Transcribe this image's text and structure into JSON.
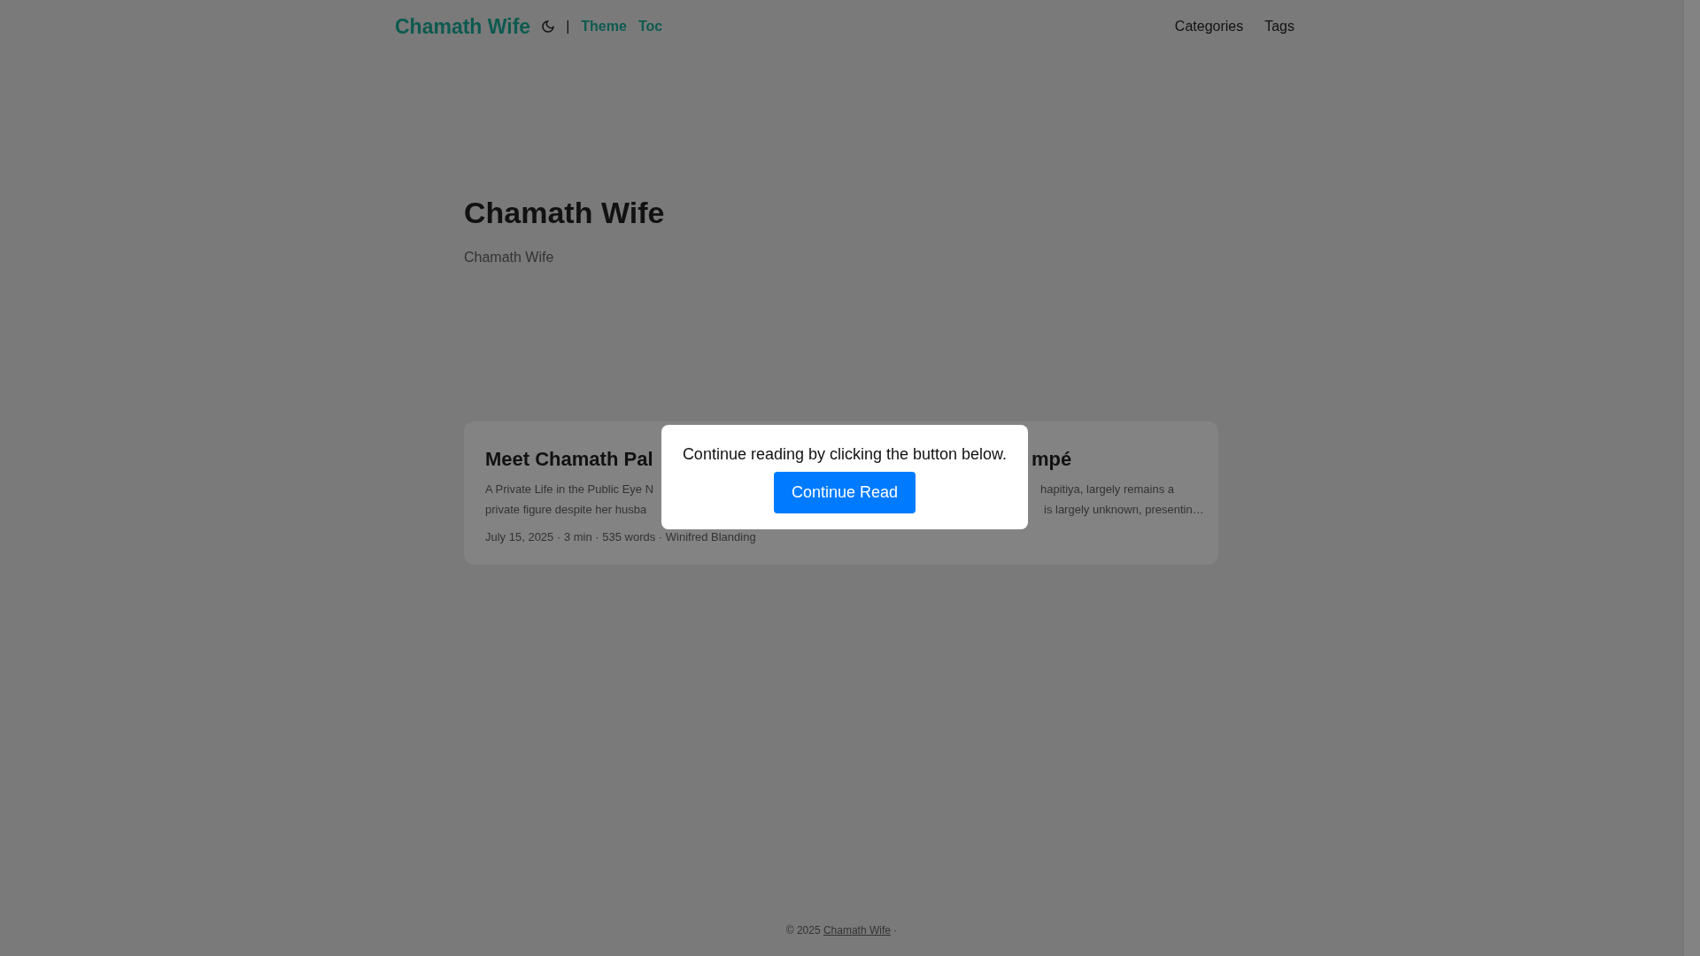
{
  "header": {
    "brand": "Chamath Wife",
    "separator": "|",
    "links": [
      "Theme",
      "Toc"
    ],
    "menu": [
      "Categories",
      "Tags"
    ]
  },
  "intro": {
    "title": "Chamath Wife",
    "subtitle": "Chamath Wife"
  },
  "post": {
    "title_left": "Meet Chamath Pal",
    "title_right": "mpé",
    "summary_left": [
      "A Private Life in the Public Eye N",
      "private figure despite her husba"
    ],
    "summary_right": [
      "hapitiya, largely remains a",
      "is largely unknown, presentin…"
    ],
    "meta": "July 15, 2025 · 3 min · 535 words · Winifred Blanding"
  },
  "modal": {
    "message": "Continue reading by clicking the button below.",
    "button": "Continue Read"
  },
  "footer": {
    "copyright": "© 2025",
    "link": "Chamath Wife",
    "dot": "·"
  }
}
